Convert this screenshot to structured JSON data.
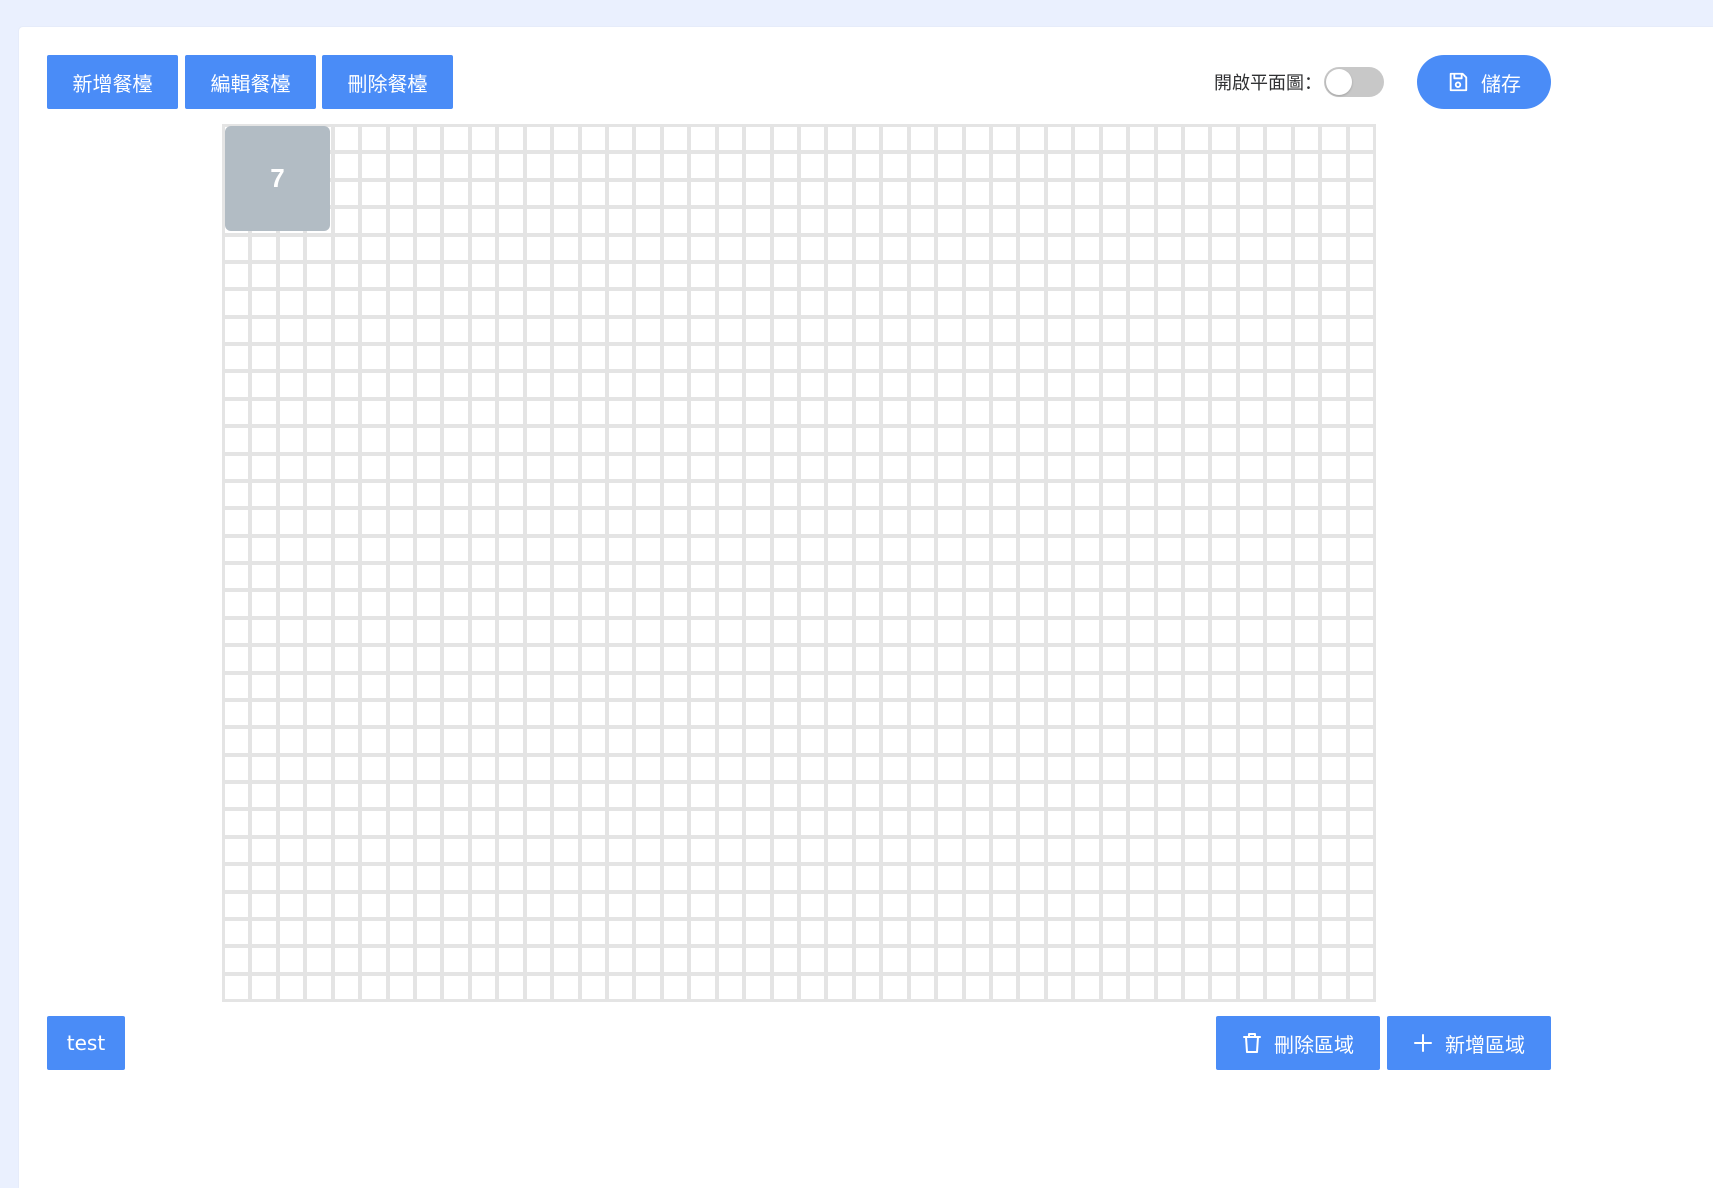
{
  "toolbar": {
    "add_restaurant": "新增餐檯",
    "edit_restaurant": "編輯餐檯",
    "delete_restaurant": "刪除餐檯",
    "floorplan_toggle_label": "開啟平面圖：",
    "floorplan_toggle_on": false,
    "save_label": "儲存",
    "save_icon": "floppy-disk-icon"
  },
  "floor": {
    "columns": 42,
    "rows": 32,
    "tables": [
      {
        "label": "7"
      }
    ]
  },
  "footer": {
    "area_tab": "test",
    "delete_area": "刪除區域",
    "delete_area_icon": "trash-icon",
    "add_area": "新增區域",
    "add_area_icon": "plus-icon"
  },
  "colors": {
    "accent": "#4a8cf7",
    "page_background": "#eaf0fe",
    "grid_line": "#e4e4e4",
    "table_block": "#b2bcc4",
    "toggle_off": "#c8c8c8"
  }
}
